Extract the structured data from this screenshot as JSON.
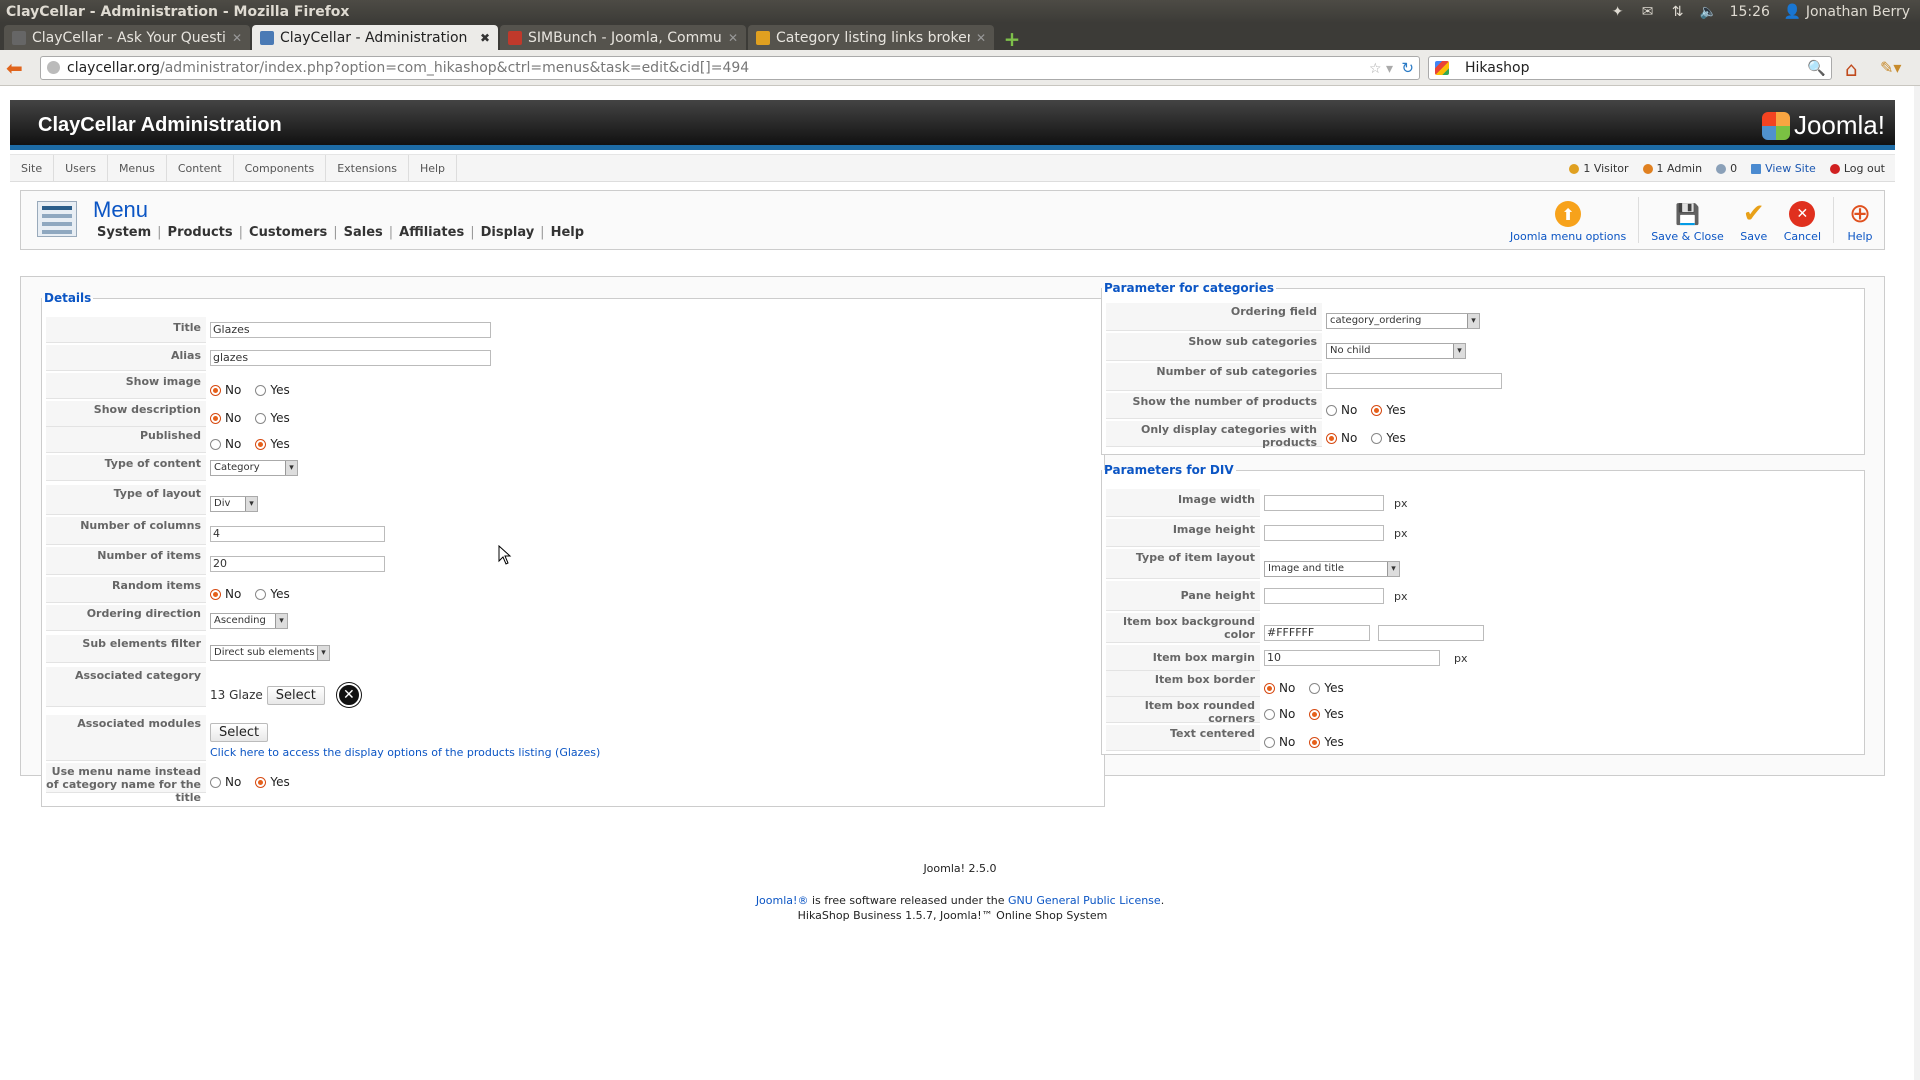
{
  "os": {
    "window_title": "ClayCellar - Administration - Mozilla Firefox",
    "clock": "15:26",
    "user": "Jonathan Berry"
  },
  "browser": {
    "tabs": [
      {
        "label": "ClayCellar - Ask Your Question",
        "fav_color": "#666"
      },
      {
        "label": "ClayCellar - Administration",
        "fav_color": "#4a7ab5"
      },
      {
        "label": "SIMBunch - Joomla, Commu...",
        "fav_color": "#c0392b"
      },
      {
        "label": "Category listing links broken",
        "fav_color": "#e0a020"
      }
    ],
    "url_host": "claycellar.org",
    "url_path": "/administrator/index.php?option=com_hikashop&ctrl=menus&task=edit&cid[]=494",
    "search_value": "Hikashop"
  },
  "joomla": {
    "header_title": "ClayCellar Administration",
    "logo_text": "Joomla!",
    "menu": [
      "Site",
      "Users",
      "Menus",
      "Content",
      "Components",
      "Extensions",
      "Help"
    ],
    "status": {
      "visitors": "1 Visitor",
      "admins": "1 Admin",
      "messages": "0",
      "view_site": "View Site",
      "logout": "Log out"
    }
  },
  "toolbar": {
    "title": "Menu",
    "submenu": [
      "System",
      "Products",
      "Customers",
      "Sales",
      "Affiliates",
      "Display",
      "Help"
    ],
    "buttons": {
      "menu_options": "Joomla menu options",
      "save_close": "Save & Close",
      "save": "Save",
      "cancel": "Cancel",
      "help": "Help"
    }
  },
  "details": {
    "legend": "Details",
    "title_label": "Title",
    "title_value": "Glazes",
    "alias_label": "Alias",
    "alias_value": "glazes",
    "show_image_label": "Show image",
    "show_description_label": "Show description",
    "published_label": "Published",
    "type_content_label": "Type of content",
    "type_content_value": "Category",
    "type_layout_label": "Type of layout",
    "type_layout_value": "Div",
    "num_columns_label": "Number of columns",
    "num_columns_value": "4",
    "num_items_label": "Number of items",
    "num_items_value": "20",
    "random_items_label": "Random items",
    "ordering_direction_label": "Ordering direction",
    "ordering_direction_value": "Ascending",
    "sub_filter_label": "Sub elements filter",
    "sub_filter_value": "Direct sub elements",
    "assoc_category_label": "Associated category",
    "assoc_category_value": "13 Glaze",
    "assoc_modules_label": "Associated modules",
    "select_label": "Select",
    "display_options_link": "Click here to access the display options of the products listing (Glazes)",
    "use_menu_name_label": "Use menu name instead of category name for the title",
    "no": "No",
    "yes": "Yes"
  },
  "categories_params": {
    "legend": "Parameter for categories",
    "ordering_field_label": "Ordering field",
    "ordering_field_value": "category_ordering",
    "show_sub_label": "Show sub categories",
    "show_sub_value": "No child",
    "num_sub_label": "Number of sub categories",
    "num_sub_value": "",
    "show_num_products_label": "Show the number of products",
    "only_display_label": "Only display categories with products"
  },
  "div_params": {
    "legend": "Parameters for DIV",
    "image_width_label": "Image width",
    "image_width_value": "",
    "image_height_label": "Image height",
    "image_height_value": "",
    "item_layout_label": "Type of item layout",
    "item_layout_value": "Image and title",
    "pane_height_label": "Pane height",
    "pane_height_value": "",
    "bg_color_label": "Item box background color",
    "bg_color_value": "#FFFFFF",
    "margin_label": "Item box margin",
    "margin_value": "10",
    "border_label": "Item box border",
    "rounded_label": "Item box rounded corners",
    "centered_label": "Text centered",
    "px": "px"
  },
  "footer": {
    "hikashop": "HikaShop Business 1.5.7, Joomla!™ Online Shop System",
    "version": "Joomla! 2.5.0",
    "joomla_link": "Joomla!®",
    "license_text": " is free software released under the ",
    "license_link": "GNU General Public License",
    "period": "."
  },
  "colors": {
    "accent": "#0b55c4",
    "header_stripe": "#1d6ba5",
    "radio_selected": "#e6601a"
  }
}
